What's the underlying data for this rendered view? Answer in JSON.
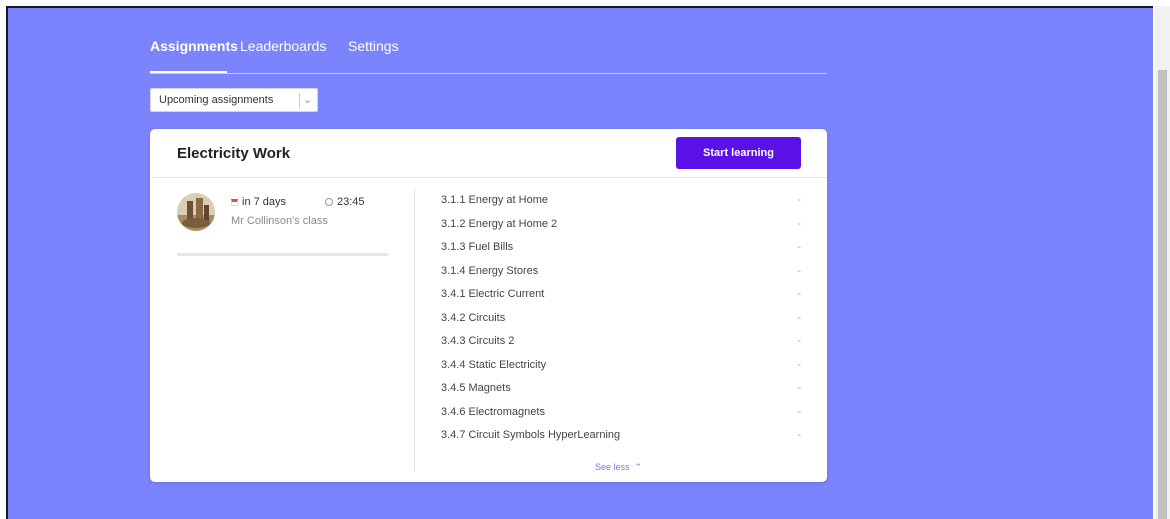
{
  "tabs": [
    {
      "label": "Assignments",
      "active": true
    },
    {
      "label": "Leaderboards",
      "active": false
    },
    {
      "label": "Settings",
      "active": false
    }
  ],
  "filter": {
    "selected": "Upcoming assignments"
  },
  "assignment": {
    "title": "Electricity Work",
    "start_button": "Start learning",
    "due": "in 7 days",
    "time": "23:45",
    "class_name": "Mr Collinson's class",
    "progress": 0,
    "lessons": [
      {
        "name": "3.1.1 Energy at Home",
        "score": "-"
      },
      {
        "name": "3.1.2 Energy at Home 2",
        "score": "-"
      },
      {
        "name": "3.1.3 Fuel Bills",
        "score": "-"
      },
      {
        "name": "3.1.4 Energy Stores",
        "score": "-"
      },
      {
        "name": "3.4.1 Electric Current",
        "score": "-"
      },
      {
        "name": "3.4.2 Circuits",
        "score": "-"
      },
      {
        "name": "3.4.3 Circuits 2",
        "score": "-"
      },
      {
        "name": "3.4.4 Static Electricity",
        "score": "-"
      },
      {
        "name": "3.4.5 Magnets",
        "score": "-"
      },
      {
        "name": "3.4.6 Electromagnets",
        "score": "-"
      },
      {
        "name": "3.4.7 Circuit Symbols HyperLearning",
        "score": "-"
      }
    ],
    "see_less": "See less"
  },
  "colors": {
    "background": "#7b83fd",
    "accent": "#5a11e8",
    "link": "#6b7fe6"
  }
}
